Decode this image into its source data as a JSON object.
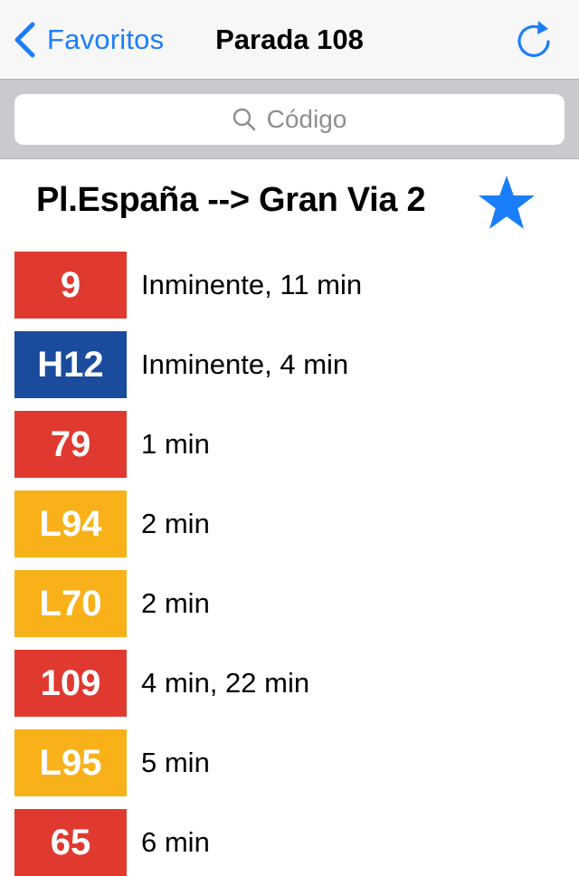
{
  "navbar": {
    "back_label": "Favoritos",
    "title": "Parada 108",
    "icons": {
      "back": "chevron-left-icon",
      "refresh": "refresh-icon"
    }
  },
  "search": {
    "placeholder": "Código",
    "icon": "search-icon"
  },
  "stop": {
    "name": "Pl.España --> Gran Via 2",
    "favorite_icon": "star-icon",
    "favorite_color": "#1a7efb"
  },
  "colors": {
    "accent": "#1a7efb",
    "red": "#e03a30",
    "blue": "#1b4b9c",
    "yellow": "#f8b119"
  },
  "routes": [
    {
      "line": "9",
      "color": "#e03a30",
      "times": "Inminente, 11 min"
    },
    {
      "line": "H12",
      "color": "#1b4b9c",
      "times": "Inminente, 4 min"
    },
    {
      "line": "79",
      "color": "#e03a30",
      "times": "1 min"
    },
    {
      "line": "L94",
      "color": "#f8b119",
      "times": "2 min"
    },
    {
      "line": "L70",
      "color": "#f8b119",
      "times": "2 min"
    },
    {
      "line": "109",
      "color": "#e03a30",
      "times": "4 min, 22 min"
    },
    {
      "line": "L95",
      "color": "#f8b119",
      "times": "5 min"
    },
    {
      "line": "65",
      "color": "#e03a30",
      "times": "6 min"
    }
  ]
}
